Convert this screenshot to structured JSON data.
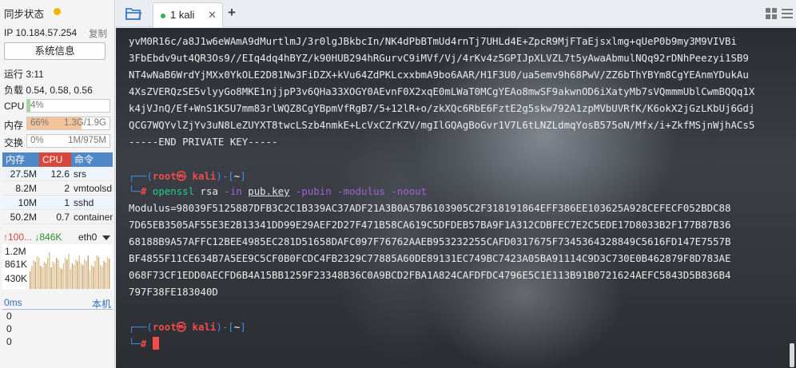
{
  "sidebar": {
    "sync_title": "同步状态",
    "ip_label": "IP 10.184.57.254",
    "copy_label": "复制",
    "sysinfo_button": "系统信息",
    "uptime": "运行 3:11",
    "load": "负载 0.54, 0.58, 0.56",
    "cpu": {
      "label": "CPU",
      "value": "4%",
      "fraction": 0.04
    },
    "mem": {
      "label": "内存",
      "percent": "66%",
      "usage": "1.3G/1.9G",
      "fraction": 0.66
    },
    "swap": {
      "label": "交换",
      "percent": "0%",
      "usage": "1M/975M",
      "fraction": 0.0
    },
    "process_table": {
      "headers": [
        "内存",
        "CPU",
        "命令"
      ],
      "rows": [
        [
          "27.5M",
          "12.6",
          "srs"
        ],
        [
          "8.2M",
          "2",
          "vmtoolsd"
        ],
        [
          "10M",
          "1",
          "sshd"
        ],
        [
          "50.2M",
          "0.7",
          "containerd"
        ]
      ]
    },
    "network": {
      "up": "↑100...",
      "down": "↓846K",
      "interface": "eth0",
      "y_labels": [
        "1.2M",
        "861K",
        "430K"
      ]
    },
    "latency": {
      "header": "0ms",
      "local_label": "本机",
      "values": [
        "0",
        "0",
        "0"
      ]
    }
  },
  "tabs": {
    "active_tab": "1 kali",
    "close_glyph": "✕",
    "add_glyph": "+"
  },
  "terminal": {
    "key_lines": [
      "yvM0R16c/a8J1w6eWAmA9dMurtlmJ/3r0lgJBkbcIn/NK4dPbBTmUd4rnTj7UHLd4E+ZpcR9MjFTaEjsxlmg+qUeP0b9my3M9VIVBi",
      "3FbEbdv9ut4QR3Os9//EIq4dq4hBYZ/k90HUB294hRGurvC9iMVf/Vj/4rKv4z5GPIJpXLVZL7t5yAwaAbmulNQq92rDNhPeezyi1SB9",
      "NT4wNaB6WrdYjMXx0YkOLE2D81Nw3FiDZX+kVu64ZdPKLcxxbmA9bo6AAR/H1F3U0/ua5emv9h68PwV/ZZ6bThYBYm8CgYEAnmYDukAu",
      "4XsZVERQzSE5vlyyGo8MKE1njjpP3v6QHa33XOGY0AEvnF0X2xqE0mLWaT0MCgYEAo8mwSF9akwnOD6iXatyMb7sVQmmmUblCwmBQQq1X",
      "k4jVJnQ/Ef+WnS1K5U7mm83rlWQZ8CgYBpmVfRgB7/5+12lR+o/zkXQc6RbE6FztE2g5skw792A1zpMVbUVRfK/K6okX2jGzLKbUj6Gdj",
      "QCG7WQYvlZjYv3uN8LeZUYXT8twcLSzb4nmkE+LcVxCZrKZV/mgIlGQAgBoGvr1V7L6tLNZLdmqYosB575oN/Mfx/i+ZkfMSjnWjhACs5",
      "-----END PRIVATE KEY-----"
    ],
    "prompt_open": "┌──(",
    "prompt_user": "root㉿ kali",
    "prompt_mid": ")-[",
    "prompt_dir": "~",
    "prompt_close": "]",
    "prompt_second": "└─",
    "prompt_hash": "#",
    "cmd": {
      "name": "openssl",
      "sub": "rsa",
      "flag_in": "-in",
      "file": "pub.key",
      "flag_pubin": "-pubin",
      "flag_modulus": "-modulus",
      "flag_noout": "-noout"
    },
    "modulus_lines": [
      "Modulus=98039F5125887DFB3C2C1B339AC37ADF21A3B0A57B6103905C2F318191864EFF386EE103625A928CEFECF052BDC88",
      "7D65EB3505AF55E3E2B13341DD99E29AEF2D27F471B58CA619C5DFDEB57BA9F1A312CDBFEC7E2C5EDE17D8033B2F177B87B36",
      "68188B9A57AFFC12BEE4985EC281D51658DAFC097F76762AAEB953232255CAFD0317675F7345364328849C5616FD147E7557B",
      "BF4855F11CE634B7A5EE9C5CF0B0FCDC4FB2329C77885A60DE89131EC749BC7423A05BA91114C9D3C730E0B462879F8D783AE",
      "068F73CF1EDD0AECFD6B4A15BB1259F23348B36C0A9BCD2FBA1A824CAFDFDC4796E5C1E113B91B0721624AEFC5843D5B836B4",
      "797F38FE183040D"
    ]
  },
  "colors": {
    "accent_blue": "#4f87c7",
    "cpu_red": "#d9463b",
    "mem_fill": "#f3c39a",
    "cpu_fill": "#9fd89f",
    "sync_dot": "#f0b400",
    "tab_green": "#2fb44a",
    "terminal_prompt_blue": "#3b8eea",
    "terminal_prompt_red": "#f14c4c",
    "terminal_cmd_green": "#23d18b",
    "terminal_flag_purple": "#a064d4"
  },
  "icons": {
    "folder": "folder-icon",
    "grid": "grid-view-icon",
    "menu": "menu-icon"
  }
}
